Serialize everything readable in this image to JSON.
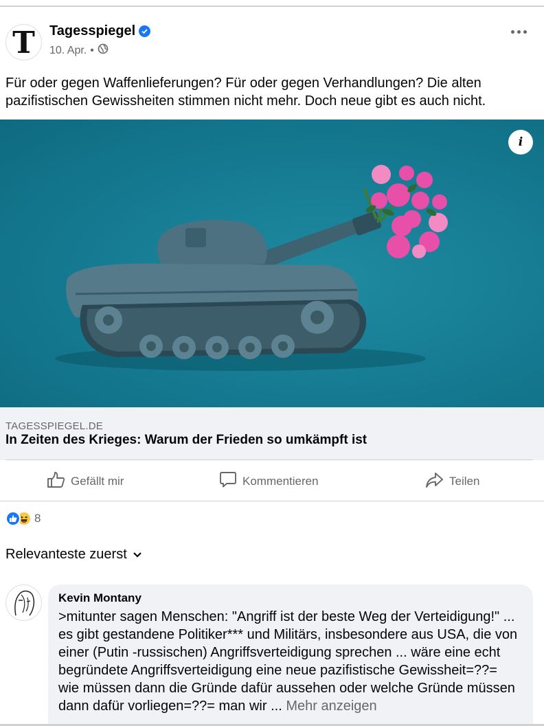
{
  "post": {
    "page_name": "Tagesspiegel",
    "avatar_letter": "T",
    "date": "10. Apr.",
    "separator": "•",
    "audience_icon": "globe-icon",
    "text": "Für oder gegen Waffenlieferungen? Für oder gegen Verhandlungen? Die alten pazifistischen Gewissheiten stimmen nicht mehr. Doch neue gibt es auch nicht."
  },
  "link": {
    "domain": "TAGESSPIEGEL.DE",
    "title": "In Zeiten des Krieges: Warum der Frieden so umkämpft ist",
    "info_label": "i"
  },
  "actions": {
    "like": "Gefällt mir",
    "comment": "Kommentieren",
    "share": "Teilen"
  },
  "reactions": {
    "types": [
      "like-icon",
      "haha-icon"
    ],
    "count": "8"
  },
  "sort": {
    "label": "Relevanteste zuerst"
  },
  "comment": {
    "author": "Kevin Montany",
    "text": ">mitunter sagen Menschen: \"Angriff ist der beste Weg der Verteidigung!\" ... es gibt gestandene  Politiker*** und Militärs, insbesondere aus USA, die von einer (Putin -russischen) Angriffsverteidigung sprechen ... wäre eine echt begründete Angriffsverteidigung eine neue pazifistische Gewissheit=??= wie müssen dann die Gründe dafür aussehen oder welche Gründe müssen dann dafür vorliegen=??= man wir",
    "ellipsis": "...",
    "more_label": "Mehr anzeigen"
  },
  "colors": {
    "accent": "#1877f2",
    "secondary_text": "#65676b",
    "link_box_bg": "#f0f2f5",
    "hero_bg": "#167d94",
    "flowers": "#e84fa9"
  }
}
